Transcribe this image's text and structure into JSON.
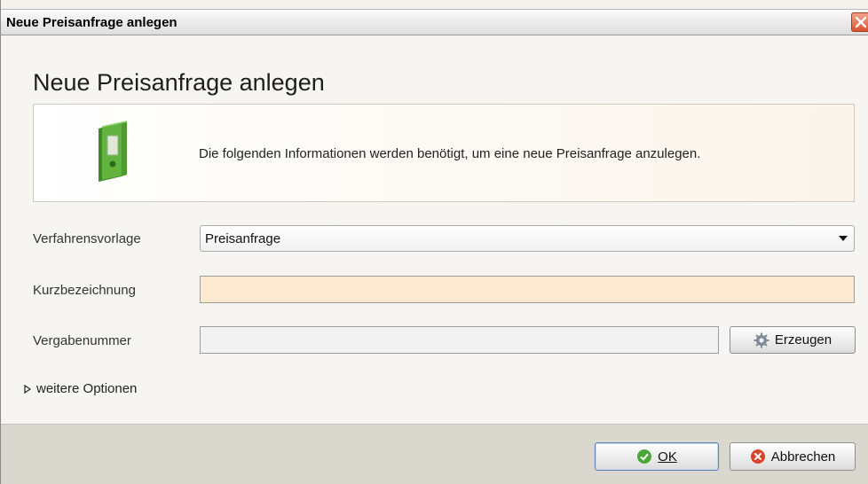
{
  "window": {
    "title": "Neue Preisanfrage anlegen"
  },
  "main": {
    "heading": "Neue Preisanfrage anlegen",
    "info_text": "Die folgenden Informationen werden benötigt, um eine neue Preisanfrage anzulegen."
  },
  "form": {
    "verfahrensvorlage": {
      "label": "Verfahrensvorlage",
      "value": "Preisanfrage"
    },
    "kurzbezeichnung": {
      "label": "Kurzbezeichnung",
      "value": "",
      "placeholder": ""
    },
    "vergabenummer": {
      "label": "Vergabenummer",
      "value": "",
      "placeholder": ""
    },
    "erzeugen_label": "Erzeugen",
    "options_label": "weitere Optionen"
  },
  "footer": {
    "ok_label": "OK",
    "cancel_label": "Abbrechen"
  },
  "icons": {
    "binder": "binder-icon",
    "gear": "gear-icon",
    "ok": "check-circle-icon",
    "cancel": "x-circle-icon"
  },
  "colors": {
    "required_field": "#fce9d0",
    "binder_green": "#5aa83a",
    "close_red": "#d9532f"
  }
}
